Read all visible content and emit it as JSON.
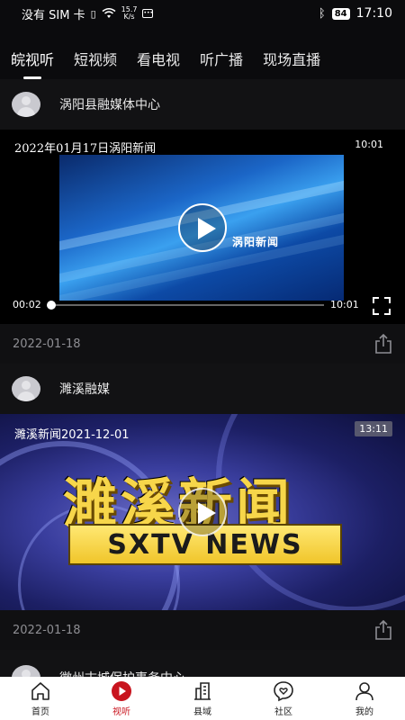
{
  "status_bar": {
    "carrier": "没有 SIM 卡",
    "net_speed_value": "15.7",
    "net_speed_unit": "K/s",
    "battery": "84",
    "time": "17:10"
  },
  "tabs": [
    {
      "label": "皖视听",
      "active": true
    },
    {
      "label": "短视频",
      "active": false
    },
    {
      "label": "看电视",
      "active": false
    },
    {
      "label": "听广播",
      "active": false
    },
    {
      "label": "现场直播",
      "active": false
    }
  ],
  "posts": [
    {
      "source": "涡阳县融媒体中心",
      "video_title": "2022年01月17日涡阳新闻",
      "duration": "10:01",
      "frame_text": "涡阳新闻",
      "current_time": "00:02",
      "total_time": "10:01",
      "progress": 0.003,
      "date": "2022-01-18"
    },
    {
      "source": "濉溪融媒",
      "video_title": "濉溪新闻2021-12-01",
      "duration": "13:11",
      "frame_big_text": "濉溪新闻",
      "frame_news_text": "SXTV NEWS",
      "date": "2022-01-18"
    },
    {
      "source": "徽州古城保护事务中心"
    }
  ],
  "bottom_nav": [
    {
      "label": "首页",
      "icon": "home-icon",
      "active": false
    },
    {
      "label": "视听",
      "icon": "play-circle-icon",
      "active": true
    },
    {
      "label": "县域",
      "icon": "building-icon",
      "active": false
    },
    {
      "label": "社区",
      "icon": "chat-heart-icon",
      "active": false
    },
    {
      "label": "我的",
      "icon": "person-icon",
      "active": false
    }
  ],
  "colors": {
    "accent": "#c8141e",
    "background": "#0b0b0d"
  }
}
